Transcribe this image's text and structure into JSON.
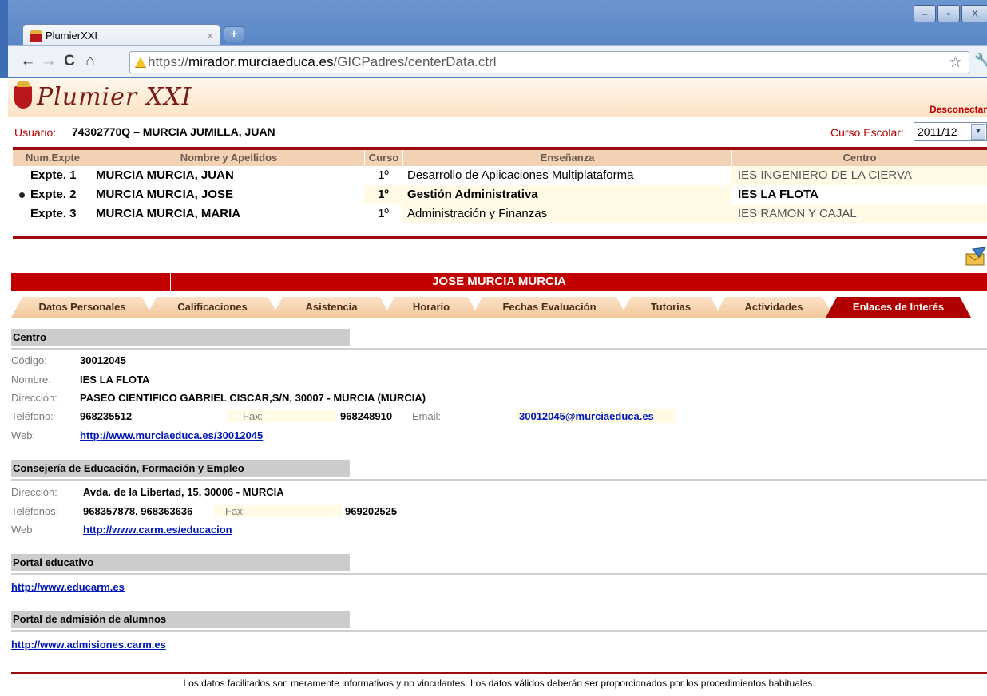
{
  "browser": {
    "tab_title": "PlumierXXI",
    "tab_close": "×",
    "new_tab": "+",
    "win_min": "–",
    "win_max": "▫",
    "win_close": "X",
    "url_scheme": "https://",
    "url_host": "mirador.murciaeduca.es",
    "url_path": "/GICPadres/centerData.ctrl"
  },
  "header": {
    "logo_text": "Plumier XXI",
    "disconnect": "Desconectar"
  },
  "userbar": {
    "user_label": "Usuario:",
    "user_value": "74302770Q – MURCIA JUMILLA, JUAN",
    "curso_label": "Curso Escolar:",
    "curso_selected": "2011/12"
  },
  "students": {
    "headers": [
      "Num.Expte",
      "Nombre y Apellidos",
      "Curso",
      "Enseñanza",
      "Centro"
    ],
    "rows": [
      {
        "expte": "Expte. 1",
        "nombre": "MURCIA MURCIA, JUAN",
        "curso": "1º",
        "ensenanza": "Desarrollo de Aplicaciones Multiplataforma",
        "centro": "IES INGENIERO DE LA CIERVA",
        "selected": false
      },
      {
        "expte": "Expte. 2",
        "nombre": "MURCIA MURCIA, JOSE",
        "curso": "1º",
        "ensenanza": "Gestión Administrativa",
        "centro": "IES LA FLOTA",
        "selected": true
      },
      {
        "expte": "Expte. 3",
        "nombre": "MURCIA MURCIA, MARIA",
        "curso": "1º",
        "ensenanza": "Administración y Finanzas",
        "centro": "IES RAMON Y CAJAL",
        "selected": false
      }
    ]
  },
  "banner_name": "JOSE MURCIA MURCIA",
  "tabs": [
    {
      "label": "Datos Personales",
      "active": false
    },
    {
      "label": "Calificaciones",
      "active": false
    },
    {
      "label": "Asistencia",
      "active": false
    },
    {
      "label": "Horario",
      "active": false
    },
    {
      "label": "Fechas Evaluación",
      "active": false
    },
    {
      "label": "Tutorias",
      "active": false
    },
    {
      "label": "Actividades",
      "active": false
    },
    {
      "label": "Enlaces de Interés",
      "active": true
    }
  ],
  "centro": {
    "title": "Centro",
    "codigo_label": "Código:",
    "codigo": "30012045",
    "nombre_label": "Nombre:",
    "nombre": "IES LA FLOTA",
    "direccion_label": "Dirección:",
    "direccion": "PASEO CIENTIFICO GABRIEL CISCAR,S/N, 30007 - MURCIA (MURCIA)",
    "telefono_label": "Teléfono:",
    "telefono": "968235512",
    "fax_label": "Fax:",
    "fax": "968248910",
    "email_label": "Email:",
    "email": "30012045@murciaeduca.es",
    "web_label": "Web:",
    "web": "http://www.murciaeduca.es/30012045"
  },
  "consejeria": {
    "title": "Consejería de Educación, Formación y Empleo",
    "direccion_label": "Dirección:",
    "direccion": "Avda. de la Libertad, 15, 30006 - MURCIA",
    "telefonos_label": "Teléfonos:",
    "telefonos": "968357878, 968363636",
    "fax_label": "Fax:",
    "fax": "969202525",
    "web_label": "Web",
    "web": "http://www.carm.es/educacion"
  },
  "portal": {
    "title": "Portal educativo",
    "link": "http://www.educarm.es"
  },
  "admision": {
    "title": "Portal de admisión de alumnos",
    "link": "http://www.admisiones.carm.es"
  },
  "footer": "Los datos facilitados son meramente informativos y no vinculantes. Los datos válidos deberán ser proporcionados por los procedimientos habituales."
}
